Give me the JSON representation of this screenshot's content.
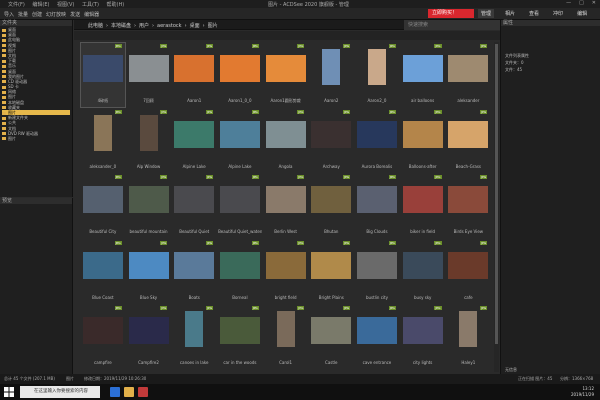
{
  "titlebar": {
    "menu": [
      "文件(F)",
      "编辑(E)",
      "视图(V)",
      "工具(T)",
      "帮助(H)"
    ],
    "title": "图片 - ACDSee 2020 旗舰版 - 管理"
  },
  "toolbar": {
    "items": [
      "导入",
      "批量",
      "创建",
      "幻灯放映",
      "发送",
      "编辑器"
    ],
    "promo": "立即购买！",
    "modes": [
      "管理",
      "相片",
      "查看",
      "冲印",
      "编辑"
    ]
  },
  "left_pane": {
    "header": "文件夹",
    "tree": [
      "桌面",
      "桌面",
      "此电脑",
      "视频",
      "图片",
      "文档",
      "下载",
      "音乐",
      "桌面",
      "我的图片",
      "CD 驱动器",
      "SD 卡",
      "网络",
      "图片",
      "本地磁盘",
      "收藏夹",
      "图片",
      "新建文件夹",
      "公共",
      "文档",
      "DVD RW 驱动器",
      "图片"
    ],
    "selected_index": 16,
    "preview_header": "预览"
  },
  "navbar": {
    "breadcrumb": [
      "此电脑",
      "本地磁盘",
      "用户",
      "aerastock",
      "桌面",
      "图片"
    ],
    "search_placeholder": "快速搜索"
  },
  "grid": {
    "items": [
      {
        "caption": "4碎纸",
        "type": "land",
        "color": "#3a4a6a"
      },
      {
        "caption": "7回顾",
        "type": "land",
        "color": "#8a8f92"
      },
      {
        "caption": "Aaron1",
        "type": "land",
        "color": "#d8712f"
      },
      {
        "caption": "Aaron1_0_0",
        "type": "land",
        "color": "#e27a30"
      },
      {
        "caption": "Aaron1圆形剪裁",
        "type": "land",
        "color": "#e58b3a"
      },
      {
        "caption": "Aaron2",
        "type": "port",
        "color": "#6f8fb5"
      },
      {
        "caption": "Aaron2_0",
        "type": "port",
        "color": "#c9a88a"
      },
      {
        "caption": "air balloons",
        "type": "land",
        "color": "#6ca0d8"
      },
      {
        "caption": "aleksander",
        "type": "land",
        "color": "#9e8a70"
      },
      {
        "caption": "aleksander_0",
        "type": "port",
        "color": "#8a7558"
      },
      {
        "caption": "Alp Window",
        "type": "port",
        "color": "#5a4a3e"
      },
      {
        "caption": "Alpine Lake",
        "type": "land",
        "color": "#3c7a6a"
      },
      {
        "caption": "Alpine Lake",
        "type": "land",
        "color": "#4e7f9a"
      },
      {
        "caption": "Angola",
        "type": "land",
        "color": "#7f8f93"
      },
      {
        "caption": "Archway",
        "type": "land",
        "color": "#3a3030"
      },
      {
        "caption": "Aurora Borealis",
        "type": "land",
        "color": "#27385c"
      },
      {
        "caption": "Balloons-after",
        "type": "land",
        "color": "#b4854a"
      },
      {
        "caption": "Beach-Grass",
        "type": "land",
        "color": "#d6a46a"
      },
      {
        "caption": "Beautiful City",
        "type": "land",
        "color": "#55606f"
      },
      {
        "caption": "beautiful mountain",
        "type": "land",
        "color": "#4e5a4a"
      },
      {
        "caption": "Beautiful Quiet",
        "type": "land",
        "color": "#4a4a4e"
      },
      {
        "caption": "Beautiful Quiet_watermark",
        "type": "land",
        "color": "#4a4a4e"
      },
      {
        "caption": "Berlin West",
        "type": "land",
        "color": "#8a7a6a"
      },
      {
        "caption": "Bhutan",
        "type": "land",
        "color": "#70603e"
      },
      {
        "caption": "Big Clouds",
        "type": "land",
        "color": "#5a6070"
      },
      {
        "caption": "biker in field",
        "type": "land",
        "color": "#99403a"
      },
      {
        "caption": "Birds Eye View",
        "type": "land",
        "color": "#8a4a3a"
      },
      {
        "caption": "Blue Coast",
        "type": "land",
        "color": "#3b6a8a"
      },
      {
        "caption": "Blue Sky",
        "type": "land",
        "color": "#4d8ac2"
      },
      {
        "caption": "Boats",
        "type": "land",
        "color": "#5a7a9a"
      },
      {
        "caption": "Borneal",
        "type": "land",
        "color": "#3a6a5a"
      },
      {
        "caption": "bright field",
        "type": "land",
        "color": "#8a6a3a"
      },
      {
        "caption": "Bright Plains",
        "type": "land",
        "color": "#b08a4a"
      },
      {
        "caption": "bustlin city",
        "type": "land",
        "color": "#6a6a6a"
      },
      {
        "caption": "busy sky",
        "type": "land",
        "color": "#3a4a5a"
      },
      {
        "caption": "cafe",
        "type": "land",
        "color": "#6a3a2a"
      },
      {
        "caption": "campfire",
        "type": "land",
        "color": "#3a2a2a"
      },
      {
        "caption": "Campfire2",
        "type": "land",
        "color": "#2a2a4a"
      },
      {
        "caption": "canoes in lake",
        "type": "port",
        "color": "#4a7a8a"
      },
      {
        "caption": "car in the woods",
        "type": "land",
        "color": "#4a5a3a"
      },
      {
        "caption": "Carol1",
        "type": "port",
        "color": "#7a6a5a"
      },
      {
        "caption": "Castle",
        "type": "land",
        "color": "#7a7a6a"
      },
      {
        "caption": "cave entrance",
        "type": "land",
        "color": "#3a6a9a"
      },
      {
        "caption": "city lights",
        "type": "land",
        "color": "#4a4a6a"
      },
      {
        "caption": "Haley1",
        "type": "port",
        "color": "#8a7a6a"
      }
    ],
    "badge": "JPG"
  },
  "right_pane": {
    "header": "属性",
    "props": [
      "文件列表属性",
      "文件夹：0",
      "文件：45"
    ],
    "footer": "无信息"
  },
  "statusbar": {
    "total": "总计 45 个文件 (207.1 MB)",
    "folder": "图片",
    "date": "修改日期：2019/11/29 10:26:30",
    "right": "正在扫描 图片：45",
    "size": "分辨：1366×768"
  },
  "taskbar": {
    "search": "在这里输入你要搜索的内容",
    "time": "13:12",
    "date": "2019/11/29"
  }
}
